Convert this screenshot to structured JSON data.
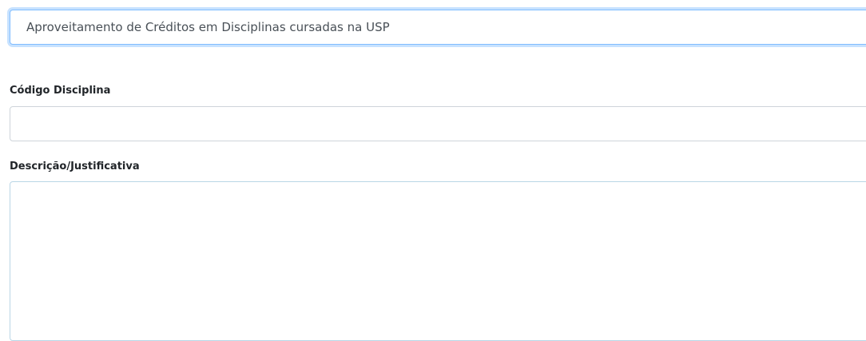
{
  "form": {
    "tipo_select": {
      "selected_value": "Aproveitamento de Créditos em Disciplinas cursadas na USP"
    },
    "codigo_disciplina": {
      "label": "Código Disciplina",
      "value": "",
      "placeholder": ""
    },
    "descricao": {
      "label": "Descrição/Justificativa",
      "value": "",
      "placeholder": ""
    }
  },
  "colors": {
    "focus_border": "#80bdff",
    "input_border": "#ced4da",
    "textarea_border": "#b9d6e6",
    "label_text": "#212529",
    "input_text": "#495057"
  }
}
